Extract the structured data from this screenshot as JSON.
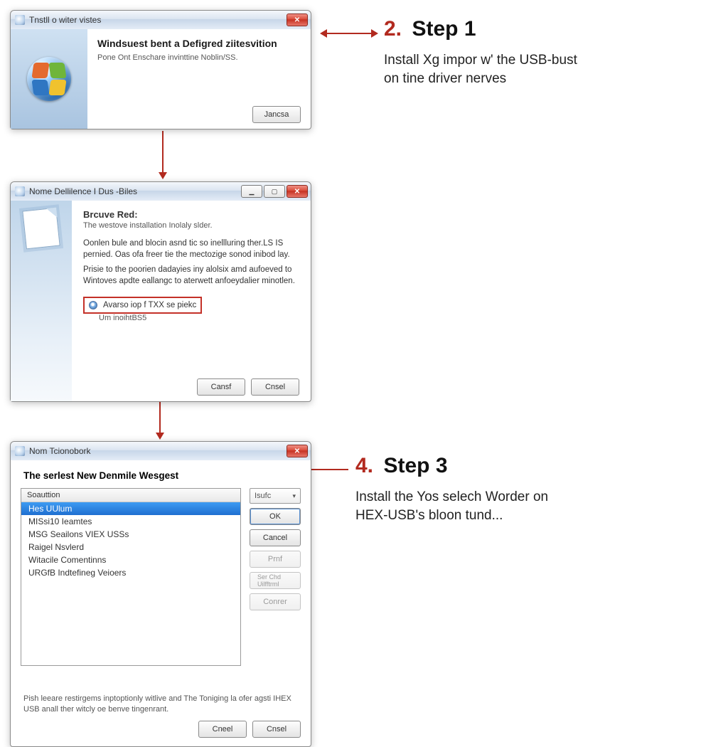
{
  "steps": {
    "one": {
      "num": "2.",
      "title": "Step 1",
      "body_line1": "Install Xg impor w' the USB-bust",
      "body_line2": "on tine driver nerves"
    },
    "three": {
      "num": "4.",
      "title": "Step 3",
      "body_line1": "Install the Yos selech Worder on",
      "body_line2": "HEX-USB's bloon tund..."
    }
  },
  "window1": {
    "title": "Tnstll o witer vistes",
    "headline": "Windsuest bent a Defigred ziitesvition",
    "sub": "Pone Ont Enschare invinttine Noblin/SS.",
    "ok_label": "Jancsa"
  },
  "window2": {
    "title": "Nome Dellilence I Dus -Biles",
    "headline": "Brcuve Red:",
    "sub": "The westove installation Inolaly slder.",
    "para1": "Oonlen bule and blocin asnd tic so inellluring ther.LS IS pernied. Oas ofa freer tie the mectozige sonod inibod lay.",
    "para2": "Prisie to the poorien dadayies iny alolsix amd aufoeved to Wintoves apdte eallangc to aterwett anfoeydalier minotlen.",
    "radio_label": "Avarso iop f TXX se piekc",
    "uninstall_label": "Um inoihtBS5",
    "btn_back": "Cansf",
    "btn_cancel": "Cnsel"
  },
  "window3": {
    "title": "Nom Tcionobork",
    "headline": "The serlest New Denmile Wesgest",
    "list_header": "Soauttion",
    "items": [
      "Hes UUlum",
      "MISsi10 Ieamtes",
      "MSG Seailons VIEX USSs",
      "Raigel Nsvlerd",
      "Witacile Comentinns",
      "URGfB Indtefineg Veioers"
    ],
    "select_label": "Isufc",
    "btn_ok": "OK",
    "btn_cancel": "Cancel",
    "btn_pref": "Prnf",
    "btn_see": "Ser Chd Uilfftrml",
    "btn_conn": "Conrer",
    "note": "Pish leeare restirgems inptoptionly witlive and The Toniging la ofer agsti IHEX USB anall ther witcly oe benve tingenrant.",
    "footer_back": "Cneel",
    "footer_cancel": "Cnsel"
  }
}
